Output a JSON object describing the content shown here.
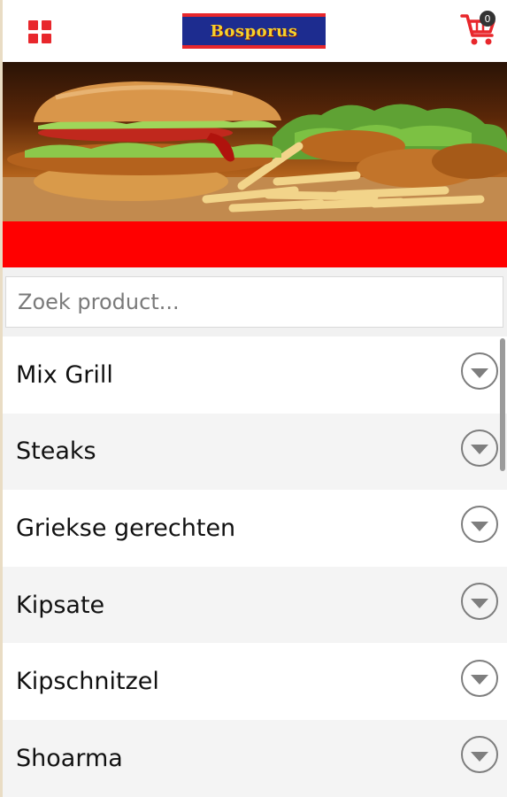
{
  "header": {
    "logo_text": "Bosporus",
    "cart_count": "0"
  },
  "search": {
    "placeholder": "Zoek product..."
  },
  "categories": [
    {
      "label": "Mix Grill"
    },
    {
      "label": "Steaks"
    },
    {
      "label": "Griekse gerechten"
    },
    {
      "label": "Kipsate"
    },
    {
      "label": "Kipschnitzel"
    },
    {
      "label": "Shoarma"
    }
  ],
  "colors": {
    "accent_red": "#ff0000",
    "logo_blue": "#1d2c8f",
    "logo_yellow": "#f7d22b"
  },
  "icons": {
    "menu": "grid-menu-icon",
    "cart": "shopping-cart-icon",
    "expand": "chevron-down-circle-icon"
  }
}
